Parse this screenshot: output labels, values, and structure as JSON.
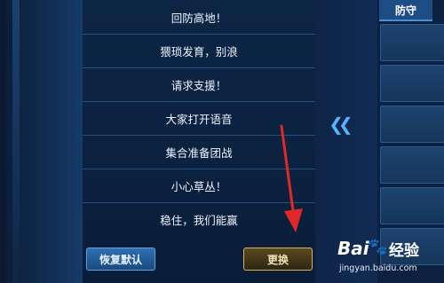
{
  "phrases": [
    "回防高地！",
    "猥琐发育，别浪",
    "请求支援！",
    "大家打开语音",
    "集合准备团战",
    "小心草丛！",
    "稳住，我们能赢"
  ],
  "buttons": {
    "reset_label": "恢复默认",
    "change_label": "更换"
  },
  "right_panel": {
    "tab_label": "防守"
  },
  "watermark": {
    "brand": "Bai",
    "brand_suffix": "经验",
    "url": "jingyan.baidu.com"
  },
  "colors": {
    "highlight_arrow": "#e02828",
    "accent_blue": "#56b4ff",
    "gold_border": "#d9b25a"
  }
}
